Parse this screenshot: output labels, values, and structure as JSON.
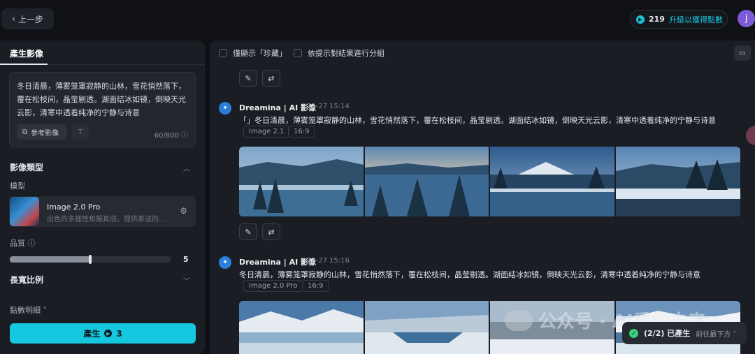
{
  "topbar": {
    "back_label": "上一步",
    "points": "219",
    "upgrade_label": "升級以獲得點數",
    "avatar_letter": "j"
  },
  "left": {
    "tab_label": "產生影像",
    "prompt": "冬日清晨，薄雾笼罩寂静的山林，雪花悄然落下，覆在松枝间，晶莹剔透。湖面结冰如镜，倒映天光云影，清寒中透着纯净的宁静与诗意",
    "ref_label": "參考影像",
    "t_icon": "T",
    "char_count": "60/800",
    "image_type_label": "影像類型",
    "model_label": "模型",
    "model_name": "Image 2.0 Pro",
    "model_desc": "出色的多樣性和擬真感。提供豪送的...",
    "quality_label": "品質",
    "quality_value": "5",
    "quality_fraction": 0.5,
    "aspect_label": "長寬比例",
    "points_detail_label": "點數明細",
    "generate_label": "產生",
    "generate_cost": "3"
  },
  "main": {
    "filter_favorites": "僅顯示「珍藏」",
    "filter_group": "依提示對結果進行分組",
    "generations": [
      {
        "title": "Dreamina | AI 影像",
        "date": "12-27",
        "time": "15:14",
        "prompt": "「」冬日清晨，薄雾笼罩寂静的山林，雪花悄然落下，覆在松枝间，晶莹剔透。湖面结冰如镜，倒映天光云影，清寒中透着纯净的宁静与诗意",
        "model_tag": "Image 2.1",
        "ratio_tag": "16:9"
      },
      {
        "title": "Dreamina | AI 影像",
        "date": "12-27",
        "time": "15:16",
        "prompt": "冬日清晨，薄雾笼罩寂静的山林，雪花悄然落下，覆在松枝间，晶莹剔透。湖面结冰如镜，倒映天光云影，清寒中透着纯净的宁静与诗意",
        "model_tag": "Image 2.0 Pro",
        "ratio_tag": "16:9"
      }
    ]
  },
  "toast": {
    "status": "(2/2) 已產生",
    "link": "前往最下方"
  },
  "watermark": "公众号 · AI重构未来",
  "colors": {
    "accent": "#16c8df",
    "background": "#0f1115",
    "panel": "#1a1d23"
  }
}
